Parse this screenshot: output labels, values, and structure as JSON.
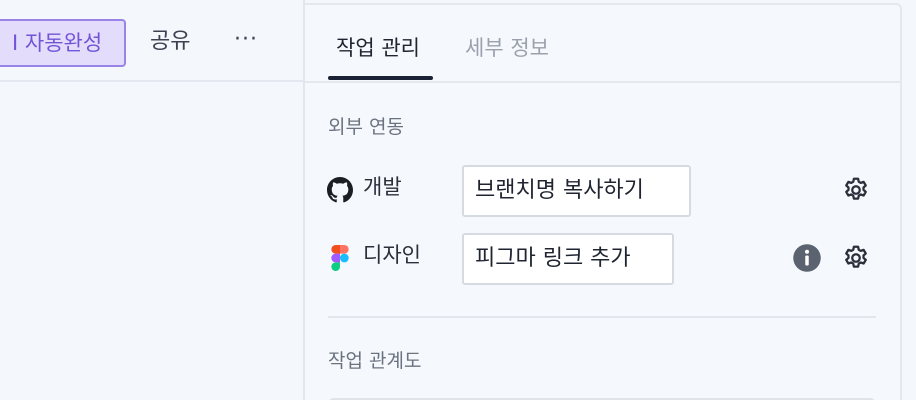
{
  "toolbar": {
    "autocomplete_label": "I 자동완성",
    "share_label": "공유",
    "more_label": "···",
    "accent": "#7254d8"
  },
  "tabs": [
    {
      "label": "작업 관리",
      "active": true
    },
    {
      "label": "세부 정보",
      "active": false
    }
  ],
  "integrations": {
    "title": "외부 연동",
    "rows": [
      {
        "icon": "github-icon",
        "label": "개발",
        "action": "브랜치명 복사하기"
      },
      {
        "icon": "figma-icon",
        "label": "디자인",
        "action": "피그마 링크 추가"
      }
    ]
  },
  "relations": {
    "title": "작업 관계도"
  }
}
